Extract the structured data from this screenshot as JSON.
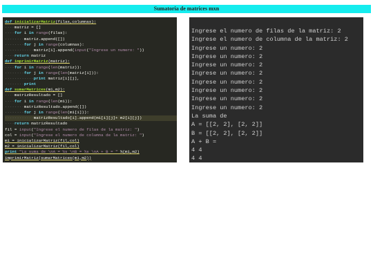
{
  "header": {
    "title": "Sumatoria de matrices mxn"
  },
  "code": {
    "lines": [
      "def inicializarMatriz(filas,columnas):",
      "    matriz = []",
      "    for i in range(filas):",
      "        matriz.append([])",
      "        for j in range(columnas):",
      "            matriz[i].append(input(\"Ingrese un numero: \"))",
      "    return matriz",
      "def imprimirMatriz(matriz):",
      "    for i in range(len(matriz)):",
      "        for j in range(len(matriz[i])):",
      "            print matriz[i][j],",
      "        print",
      "def sumarMatrices(m1,m2):",
      "    matrizResultado = []",
      "    for i in range(len(m1)):",
      "        matrizResultado.append([])",
      "        for j in range(len(m1[i])):",
      "            matrizResultado[i].append(m1[i][j]+ m2[i][j])",
      "    return matrizResultado",
      "fil = input(\"Ingrese el numero de filas de la matriz: \")",
      "col = input(\"Ingrese el numero de columna de la matriz: \")",
      "m1 = inicializarMatriz(fil,col)",
      "m2 = inicializarMatriz(fil,col)",
      "print \"La suma de \\nA = %s \\nB = %s \\nA + B = \" %(m1,m2)",
      "imprimirMatriz(sumarMatrices(m1,m2))"
    ]
  },
  "output": {
    "lines": [
      "Ingrese el numero de filas de la matriz: 2",
      "Ingrese el numero de columna de la matriz: 2",
      "Ingrese un numero: 2",
      "Ingrese un numero: 2",
      "Ingrese un numero: 2",
      "Ingrese un numero: 2",
      "Ingrese un numero: 2",
      "Ingrese un numero: 2",
      "Ingrese un numero: 2",
      "Ingrese un numero: 2",
      "La suma de",
      "A = [[2, 2], [2, 2]]",
      "B = [[2, 2], [2, 2]]",
      "A + B =",
      "4 4",
      "4 4"
    ]
  },
  "colors": {
    "banner": "#15ecee",
    "code_background": "#272822",
    "output_background": "#2b2b2b",
    "keyword": "#66d9ef",
    "function_name": "#a6e22e",
    "string": "#b48ead"
  }
}
